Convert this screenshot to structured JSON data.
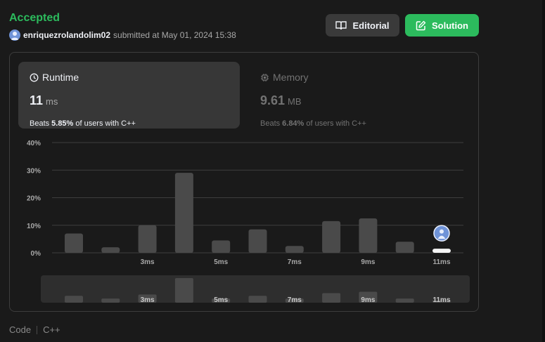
{
  "header": {
    "status": "Accepted",
    "username": "enriquezrolandolim02",
    "submitted_text": "submitted at May 01, 2024 15:38",
    "editorial_label": "Editorial",
    "solution_label": "Solution"
  },
  "runtime": {
    "title": "Runtime",
    "value": "11",
    "unit": "ms",
    "beats_prefix": "Beats",
    "beats_pct": "5.85%",
    "beats_suffix": "of users with C++"
  },
  "memory": {
    "title": "Memory",
    "value": "9.61",
    "unit": "MB",
    "beats_prefix": "Beats",
    "beats_pct": "6.84%",
    "beats_suffix": "of users with C++"
  },
  "footer": {
    "code_label": "Code",
    "language": "C++"
  },
  "colors": {
    "accent_green": "#2cbb5d",
    "bar": "#4a4a4a",
    "highlight_bar": "#f5f5f5"
  },
  "chart_data": {
    "type": "bar",
    "y_ticks": [
      "40%",
      "30%",
      "20%",
      "10%",
      "0%"
    ],
    "ylim": [
      0,
      40
    ],
    "x_labels": [
      "",
      "",
      "3ms",
      "",
      "5ms",
      "",
      "7ms",
      "",
      "9ms",
      "",
      "11ms"
    ],
    "values": [
      7,
      2,
      10,
      29,
      4.5,
      8.5,
      2.5,
      11.5,
      12.5,
      4,
      1.5
    ],
    "highlight_index": 10,
    "overview_values": [
      2.5,
      1.5,
      3,
      9,
      1.5,
      2.5,
      1.5,
      3.5,
      4,
      1.5,
      1
    ]
  }
}
